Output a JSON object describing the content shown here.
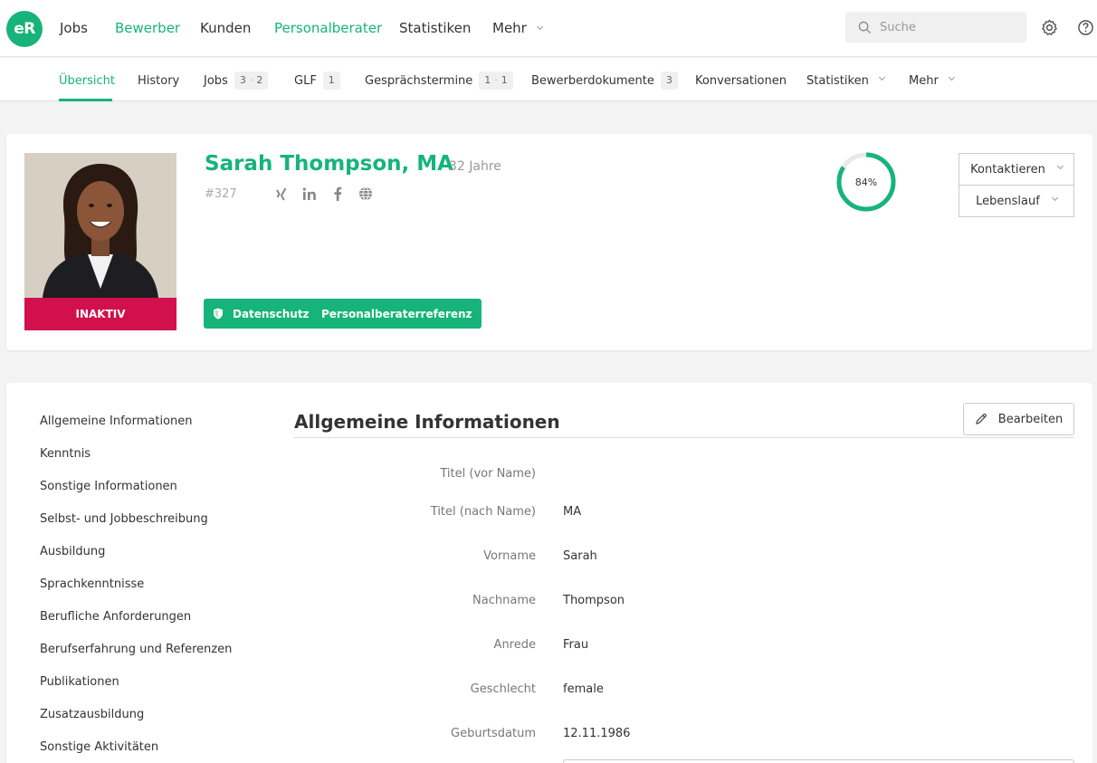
{
  "app": {
    "logo_text": "eR"
  },
  "top_nav": {
    "items": [
      "Jobs",
      "Bewerber",
      "Kunden",
      "Personalberater",
      "Statistiken",
      "Mehr"
    ],
    "search_placeholder": "Suche"
  },
  "sub_nav": {
    "overview": "Übersicht",
    "history": "History",
    "jobs": "Jobs",
    "jobs_counts": [
      "3",
      "2"
    ],
    "glf": "GLF",
    "glf_count": "1",
    "termine": "Gesprächstermine",
    "termine_counts": [
      "1",
      "1"
    ],
    "dokumente": "Bewerberdokumente",
    "dokumente_count": "3",
    "konversationen": "Konversationen",
    "statistiken": "Statistiken",
    "mehr": "Mehr"
  },
  "profile": {
    "name": "Sarah Thompson, MA",
    "age": "32 Jahre",
    "id": "#327",
    "status": "INAKTIV",
    "completeness_pct": 84,
    "completeness_label": "84%",
    "btn_datenschutz": "Datenschutz",
    "btn_referenz": "Personalberaterreferenz",
    "btn_kontaktieren": "Kontaktieren",
    "btn_lebenslauf": "Lebenslauf",
    "socials": [
      "xing-icon",
      "linkedin-icon",
      "facebook-icon",
      "globe-icon"
    ]
  },
  "sidebar": {
    "items": [
      "Allgemeine Informationen",
      "Kenntnis",
      "Sonstige Informationen",
      "Selbst- und Jobbeschreibung",
      "Ausbildung",
      "Sprachkenntnisse",
      "Berufliche Anforderungen",
      "Berufserfahrung und Referenzen",
      "Publikationen",
      "Zusatzausbildung",
      "Sonstige Aktivitäten"
    ]
  },
  "general_info": {
    "title": "Allgemeine Informationen",
    "edit_label": "Bearbeiten",
    "fields": [
      {
        "label": "Titel (vor Name)",
        "value": ""
      },
      {
        "label": "Titel (nach Name)",
        "value": "MA"
      },
      {
        "label": "Vorname",
        "value": "Sarah"
      },
      {
        "label": "Nachname",
        "value": "Thompson"
      },
      {
        "label": "Anrede",
        "value": "Frau"
      },
      {
        "label": "Geschlecht",
        "value": "female"
      },
      {
        "label": "Geburtsdatum",
        "value": "12.11.1986"
      }
    ]
  },
  "colors": {
    "accent": "#16b47a",
    "inactive": "#d1104d"
  }
}
